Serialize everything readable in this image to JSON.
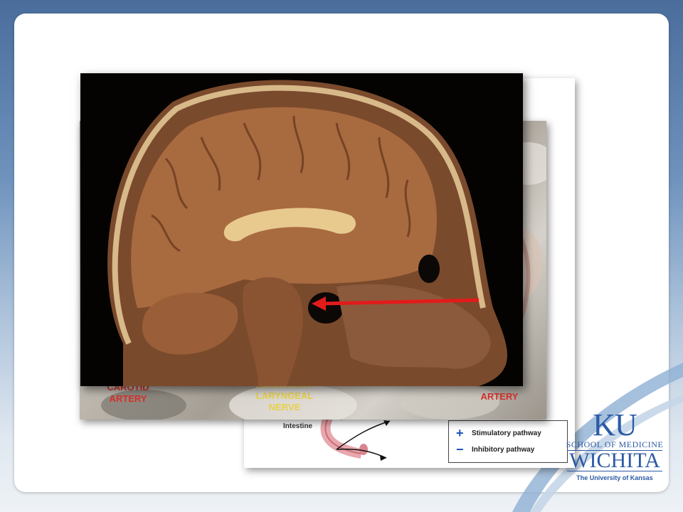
{
  "slide": {
    "images": {
      "diagram": {
        "intestine_label": "Intestine",
        "legend": [
          {
            "sign": "+",
            "text": "Stimulatory pathway"
          },
          {
            "sign": "−",
            "text": "Inhibitory pathway"
          }
        ]
      },
      "dissection": {
        "label_left": "CAROTID\nARTERY",
        "label_center": "RECURRENT\nLARYNGEAL\nNERVE",
        "label_right": "ARTERY"
      }
    },
    "logo": {
      "ku": "KU",
      "school": "SCHOOL OF MEDICINE",
      "campus": "WICHITA",
      "university": "The University of Kansas"
    }
  },
  "colors": {
    "accent_blue": "#2c5aa5",
    "arrow_red": "#e21b1b",
    "label_red": "#d8302b",
    "label_yellow": "#e8d04a"
  }
}
